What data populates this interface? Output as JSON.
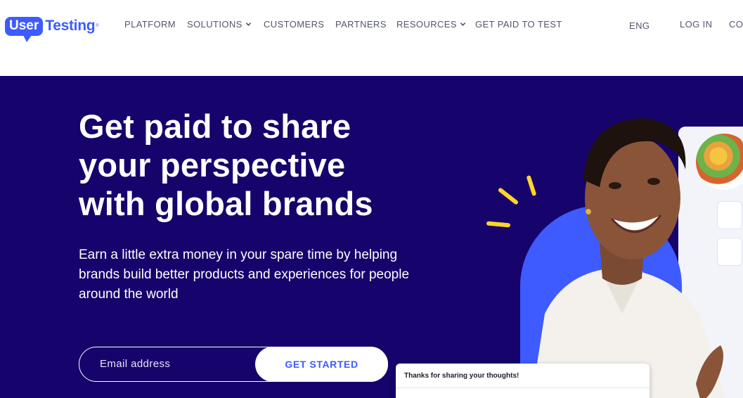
{
  "brand": {
    "logo_part1": "User",
    "logo_part2": "Testing",
    "trademark": "®",
    "accent_color": "#3d5bff",
    "hero_bg_color": "#16036b",
    "highlight_color": "#ffd52b"
  },
  "nav": {
    "items": [
      {
        "label": "PLATFORM",
        "has_dropdown": false
      },
      {
        "label": "SOLUTIONS",
        "has_dropdown": true
      },
      {
        "label": "CUSTOMERS",
        "has_dropdown": false
      },
      {
        "label": "PARTNERS",
        "has_dropdown": false
      },
      {
        "label": "RESOURCES",
        "has_dropdown": true
      },
      {
        "label": "GET PAID TO TEST",
        "has_dropdown": false
      }
    ],
    "language": "ENG",
    "login": "LOG IN",
    "contact_truncated": "CO"
  },
  "hero": {
    "headline_line1": "Get paid to share",
    "headline_line2": "your perspective",
    "headline_line3": "with global brands",
    "subtext_line1": "Earn a little extra money in your spare time by helping",
    "subtext_line2": "brands build better products and experiences for people",
    "subtext_line3": "around the world",
    "email_placeholder": "Email address",
    "email_value": "",
    "cta_label": "GET STARTED"
  },
  "illustration": {
    "feedback_card_text": "Thanks for sharing your thoughts!"
  }
}
